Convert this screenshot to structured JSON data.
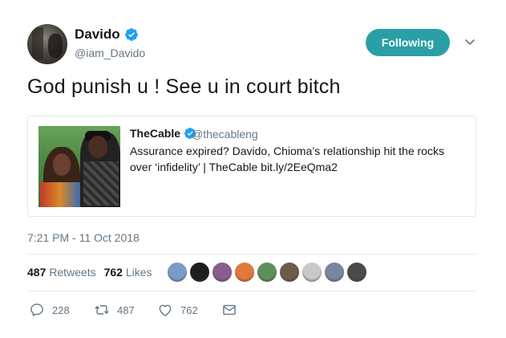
{
  "header": {
    "display_name": "Davido",
    "handle": "@iam_Davido",
    "follow_label": "Following",
    "verified_icon": "verified-badge-icon"
  },
  "tweet": {
    "text": "God punish u ! See u in court bitch",
    "timestamp": "7:21 PM - 11 Oct 2018"
  },
  "quoted": {
    "name": "TheCable",
    "handle": "@thecableng",
    "text": "Assurance expired? Davido, Chioma’s relationship hit the rocks over ‘infidelity’ | TheCable bit.ly/2EeQma2"
  },
  "stats": {
    "retweets_count": "487",
    "retweets_label": "Retweets",
    "likes_count": "762",
    "likes_label": "Likes"
  },
  "likers": [
    {
      "color": "#7a9cc9"
    },
    {
      "color": "#1e1e1e"
    },
    {
      "color": "#8b5c8e"
    },
    {
      "color": "#e07a3a"
    },
    {
      "color": "#5d8f5a"
    },
    {
      "color": "#6d5c4a"
    },
    {
      "color": "#c9c9c9"
    },
    {
      "color": "#7a86a0"
    },
    {
      "color": "#4a4a4a"
    }
  ],
  "actions": {
    "reply_count": "228",
    "retweet_count": "487",
    "like_count": "762"
  },
  "colors": {
    "accent": "#2a9fa6",
    "verified": "#1da1f2",
    "muted": "#657786"
  }
}
